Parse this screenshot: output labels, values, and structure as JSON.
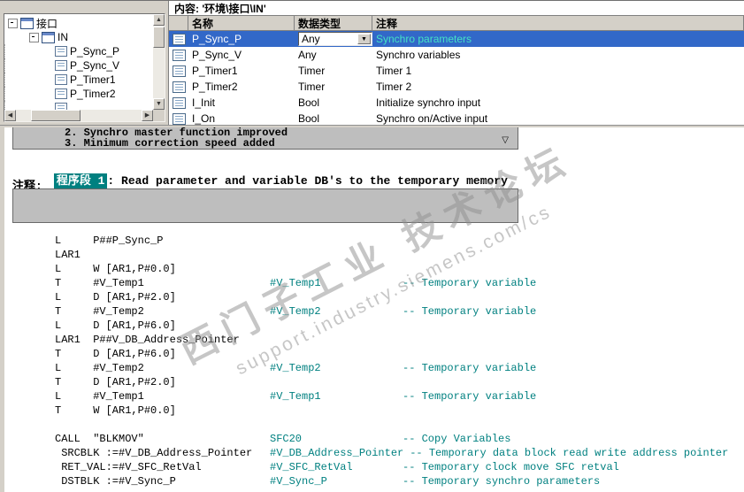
{
  "header": {
    "content_label": "内容:  '环境\\接口\\IN'"
  },
  "tree": {
    "root": "接口",
    "node": "IN",
    "children": [
      "P_Sync_P",
      "P_Sync_V",
      "P_Timer1",
      "P_Timer2"
    ],
    "partial_child": true
  },
  "table": {
    "columns": [
      "名称",
      "数据类型",
      "注释"
    ],
    "rows": [
      {
        "name": "P_Sync_P",
        "type": "Any",
        "comment": "Synchro parameters",
        "selected": true,
        "combo": true
      },
      {
        "name": "P_Sync_V",
        "type": "Any",
        "comment": "Synchro variables"
      },
      {
        "name": "P_Timer1",
        "type": "Timer",
        "comment": "Timer 1"
      },
      {
        "name": "P_Timer2",
        "type": "Timer",
        "comment": "Timer 2"
      },
      {
        "name": "I_Init",
        "type": "Bool",
        "comment": "Initialize synchro input"
      },
      {
        "name": "I_On",
        "type": "Bool",
        "comment": "Synchro on/Active input"
      }
    ]
  },
  "editor": {
    "history_lines": [
      "2. Synchro master function improved",
      "3. Minimum correction speed added"
    ],
    "network_label": "程序段 1",
    "network_title": ": Read parameter and variable DB's to the temporary memory",
    "comment_label": "注释:",
    "code": [
      {
        "c": "L     P##P_Sync_P"
      },
      {
        "c": "LAR1"
      },
      {
        "c": "L     W [AR1,P#0.0]"
      },
      {
        "c": "T     #V_Temp1",
        "s": "#V_Temp1",
        "m": "-- Temporary variable"
      },
      {
        "c": "L     D [AR1,P#2.0]"
      },
      {
        "c": "T     #V_Temp2",
        "s": "#V_Temp2",
        "m": "-- Temporary variable"
      },
      {
        "c": "L     D [AR1,P#6.0]"
      },
      {
        "c": "LAR1  P##V_DB_Address_Pointer"
      },
      {
        "c": "T     D [AR1,P#6.0]"
      },
      {
        "c": "L     #V_Temp2",
        "s": "#V_Temp2",
        "m": "-- Temporary variable"
      },
      {
        "c": "T     D [AR1,P#2.0]"
      },
      {
        "c": "L     #V_Temp1",
        "s": "#V_Temp1",
        "m": "-- Temporary variable"
      },
      {
        "c": "T     W [AR1,P#0.0]"
      },
      {
        "c": ""
      },
      {
        "c": "CALL  \"BLKMOV\"",
        "s": "SFC20",
        "m": "-- Copy Variables"
      },
      {
        "c": " SRCBLK :=#V_DB_Address_Pointer",
        "s": "#V_DB_Address_Pointer",
        "m": "-- Temporary data block read write address pointer"
      },
      {
        "c": " RET_VAL:=#V_SFC_RetVal",
        "s": "#V_SFC_RetVal",
        "m": "-- Temporary clock move SFC retval"
      },
      {
        "c": " DSTBLK :=#V_Sync_P",
        "s": "#V_Sync_P",
        "m": "-- Temporary synchro parameters"
      }
    ]
  },
  "icons": {
    "collapse_triangle": "▽",
    "scroll_up": "▲",
    "scroll_down": "▼",
    "scroll_left": "◀",
    "scroll_right": "▶",
    "combo_arrow": "▼"
  },
  "watermark": {
    "line1": "西门子工业  技术论坛",
    "line2": "support.industry.siemens.com/cs"
  },
  "colors": {
    "selection": "#3268C8",
    "network_bg": "#008080",
    "code_comment": "#008080"
  }
}
